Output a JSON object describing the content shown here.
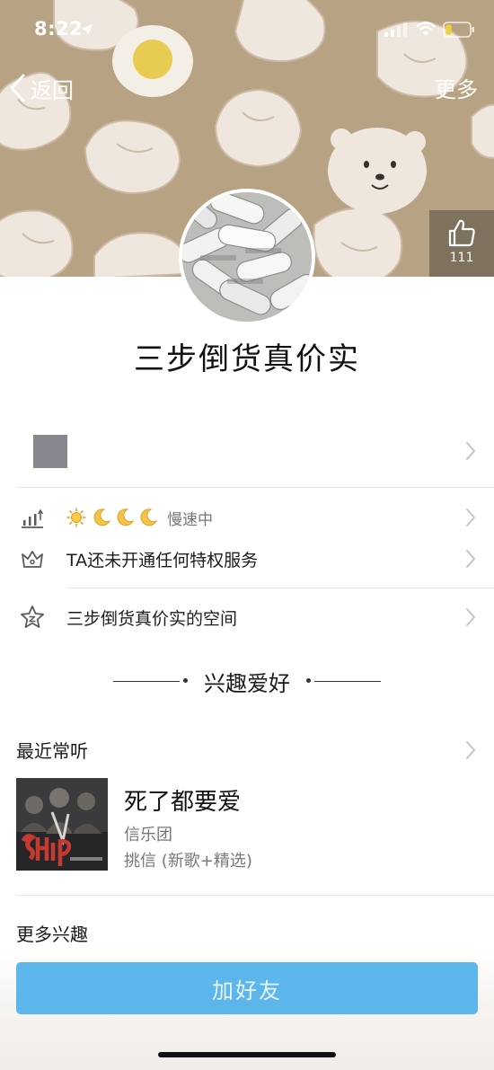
{
  "status_bar": {
    "time": "8:22"
  },
  "nav": {
    "back_label": "返回",
    "more_label": "更多"
  },
  "like": {
    "count": "111"
  },
  "profile": {
    "name": "三步倒货真价实"
  },
  "rows": {
    "level_status": "慢速中",
    "privilege_text": "TA还未开通任何特权服务",
    "space_text": "三步倒货真价实的空间"
  },
  "level_icons": [
    "sun-icon",
    "moon-icon",
    "moon-icon",
    "moon-icon"
  ],
  "interests": {
    "section_title": "兴趣爱好",
    "music_label": "最近常听",
    "song_title": "死了都要爱",
    "song_artist": "信乐团",
    "song_album": "挑信 (新歌+精选)",
    "more_label": "更多兴趣"
  },
  "add_friend_label": "加好友",
  "colors": {
    "cover_bg": "#b7a283",
    "button_bg": "#5cb6ec",
    "gray_square": "#878790",
    "secondary_text": "#777777"
  }
}
